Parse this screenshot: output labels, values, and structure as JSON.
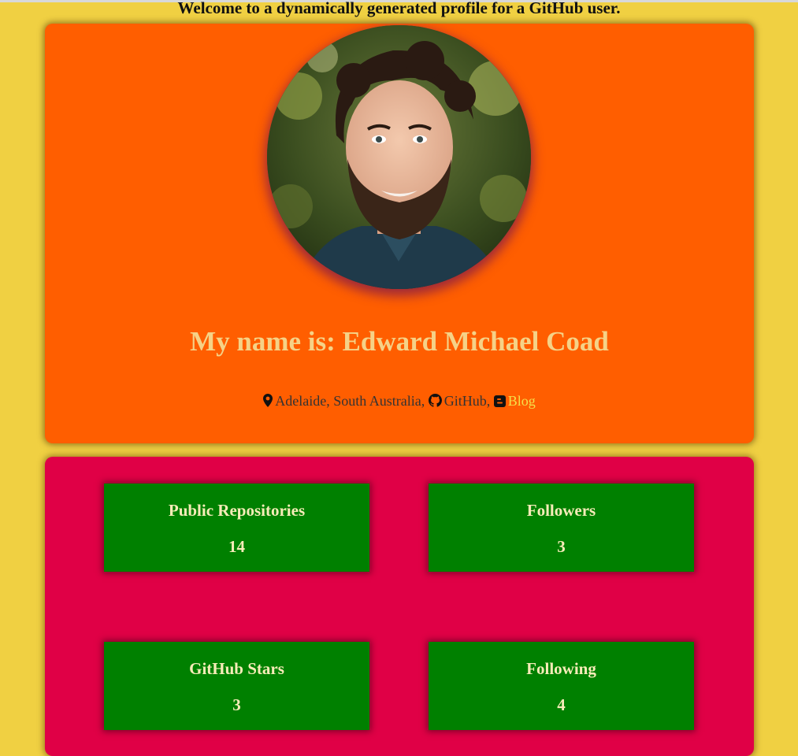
{
  "header": {
    "welcome_text": "Welcome to a dynamically generated profile for a GitHub user."
  },
  "profile": {
    "avatar_alt": "profile photo",
    "name_heading": "My name is: Edward Michael Coad",
    "location": "Adelaide, South Australia,",
    "github_label": "GitHub,",
    "blog_label": "Blog",
    "icons": {
      "location": "map-marker-icon",
      "github": "github-icon",
      "blog": "blogger-icon"
    }
  },
  "stats": [
    {
      "label": "Public Repositories",
      "value": "14"
    },
    {
      "label": "Followers",
      "value": "3"
    },
    {
      "label": "GitHub Stars",
      "value": "3"
    },
    {
      "label": "Following",
      "value": "4"
    }
  ],
  "colors": {
    "page_background": "#f0d042",
    "profile_card": "#ff5e00",
    "stats_card": "#e00046",
    "stat_box": "#008000",
    "heading_text": "#f5d287",
    "blog_link": "#f5e04a"
  }
}
